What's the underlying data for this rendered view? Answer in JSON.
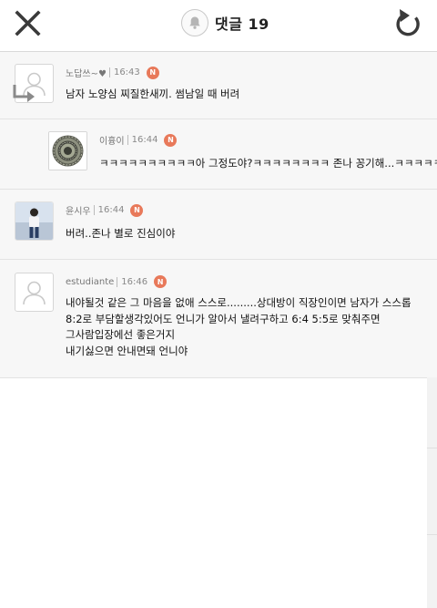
{
  "header": {
    "close_icon": "close-icon",
    "bell_icon": "bell-icon",
    "refresh_icon": "refresh-icon",
    "title": "댓글 19"
  },
  "badge_label": "N",
  "colors": {
    "badge": "#e8795a",
    "text": "#111111",
    "meta": "#777777",
    "list_bg": "#f7f7f7"
  },
  "comments": [
    {
      "author": "노답쓰~♥",
      "time": "16:43",
      "avatar": "default-avatar-icon",
      "is_reply": false,
      "lines": [
        "남자 노양심 찌질한새끼. 썸남일 때 버려"
      ]
    },
    {
      "author": "이흉이",
      "time": "16:44",
      "avatar": "circular-pattern-avatar",
      "is_reply": true,
      "lines": [
        "ㅋㅋㅋㅋㅋㅋㅋㅋㅋㅋ아 그정도야?ㅋㅋㅋㅋㅋㅋㅋㅋ 존나 꽁기해...ㅋㅋㅋㅋㅋㅋ"
      ]
    },
    {
      "author": "윤시우",
      "time": "16:44",
      "avatar": "person-photo-avatar",
      "is_reply": false,
      "lines": [
        "버려..존나 별로 진심이야"
      ]
    },
    {
      "author": "estudiante",
      "time": "16:46",
      "avatar": "default-avatar-icon",
      "is_reply": false,
      "lines": [
        "내야될것 같은 그 마음을 없애 스스로.........상대방이 직장인이면 남자가 스스롭",
        "8:2로 부담할생각있어도 언니가 알아서 낼려구하고 6:4 5:5로 맞춰주면",
        "그사람입장에선 좋은거지",
        "내기싫으면 안내면돼 언니야"
      ]
    }
  ]
}
